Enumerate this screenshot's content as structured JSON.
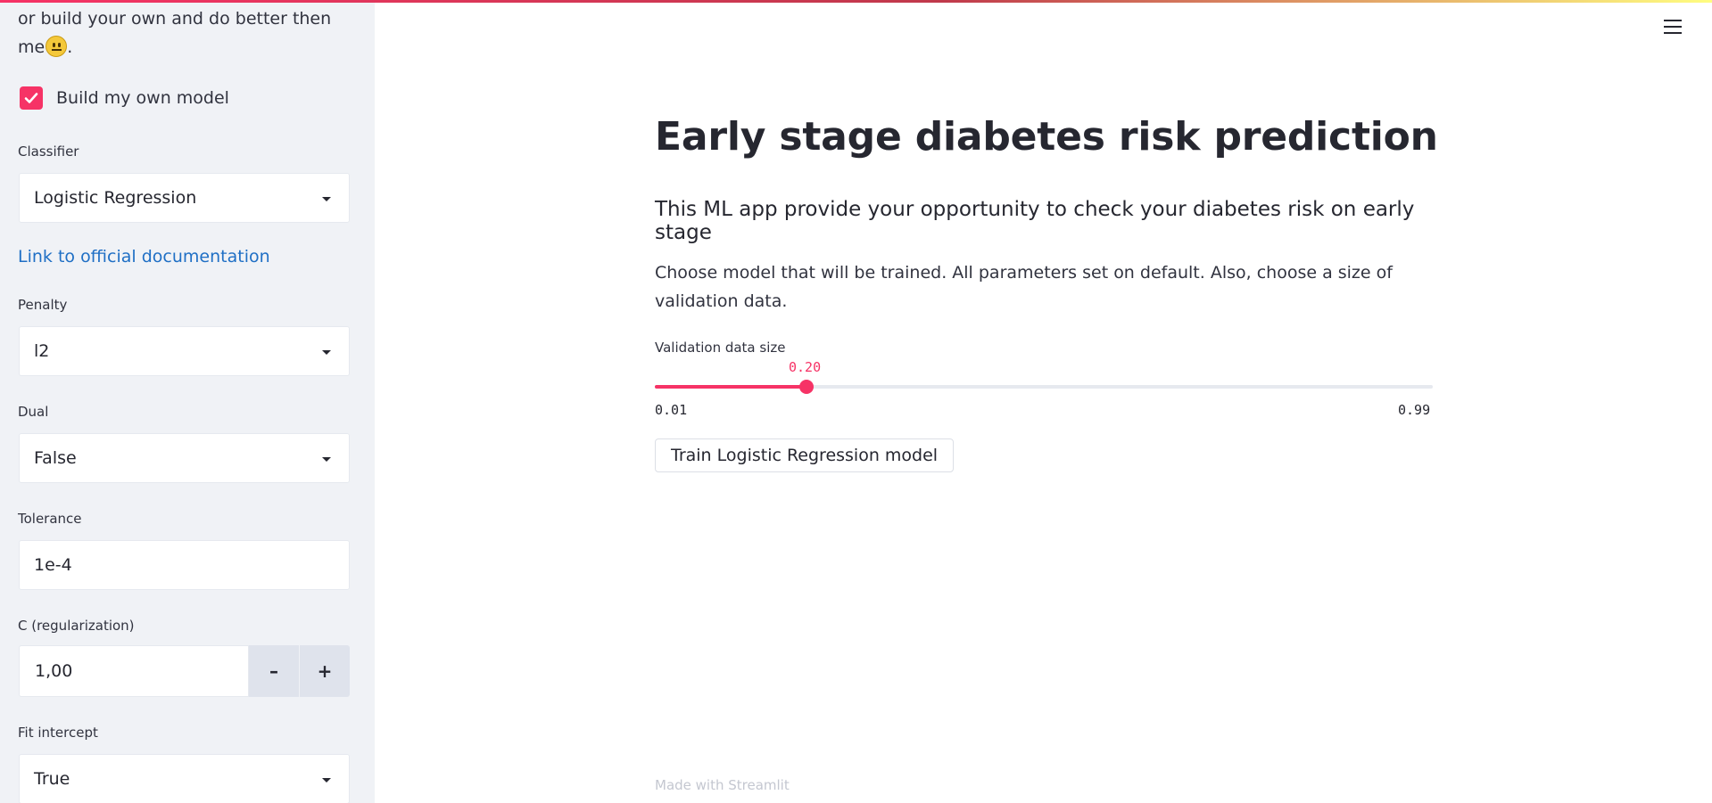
{
  "sidebar": {
    "intro_text": "you can use my model you can pick her or build your own and do better then me",
    "intro_emoji": "slightly-frowning-face",
    "build_own_model": {
      "label": "Build my own model",
      "checked": true
    },
    "classifier": {
      "label": "Classifier",
      "value": "Logistic Regression"
    },
    "doc_link": "Link to official documentation",
    "penalty": {
      "label": "Penalty",
      "value": "l2"
    },
    "dual": {
      "label": "Dual",
      "value": "False"
    },
    "tolerance": {
      "label": "Tolerance",
      "value": "1e-4"
    },
    "c_reg": {
      "label": "C (regularization)",
      "value": "1,00",
      "minus": "–",
      "plus": "+"
    },
    "fit_intercept": {
      "label": "Fit intercept",
      "value": "True"
    }
  },
  "main": {
    "title": "Early stage diabetes risk prediction",
    "subtitle": "This ML app provide your opportunity to check your diabetes risk on early stage",
    "description": "Choose model that will be trained. All parameters set on default. Also, choose a size of validation data.",
    "slider": {
      "label": "Validation data size",
      "value": "0.20",
      "min": "0.01",
      "max": "0.99",
      "fraction": 0.1939
    },
    "train_button": "Train Logistic Regression model",
    "footer": "Made with Streamlit"
  },
  "colors": {
    "primary": "#f63366",
    "link": "#1f6fc5",
    "sidebar_bg": "#f0f2f6"
  },
  "icons": [
    "checkmark-icon",
    "caret-down-icon",
    "hamburger-menu-icon"
  ]
}
